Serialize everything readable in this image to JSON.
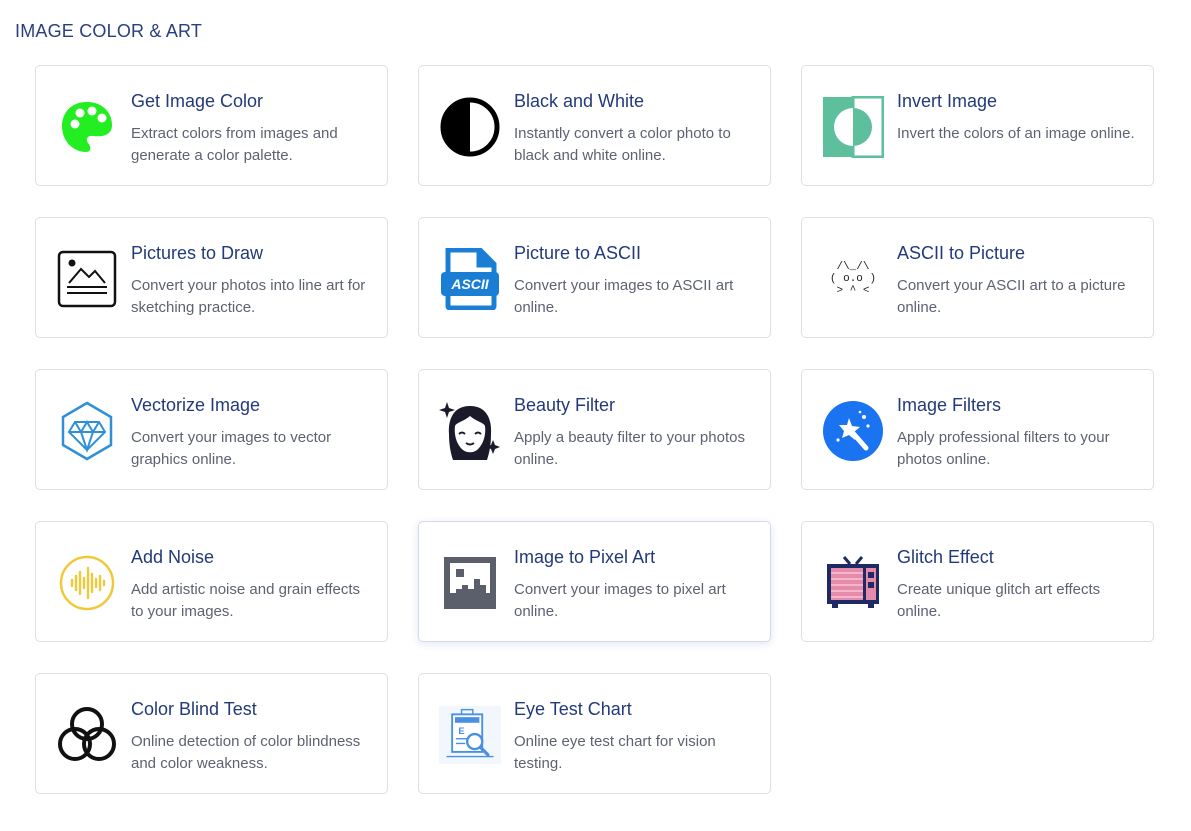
{
  "section": {
    "title": "IMAGE COLOR & ART"
  },
  "tools": [
    {
      "title": "Get Image Color",
      "desc": "Extract colors from images and generate a color palette.",
      "icon": "palette-icon"
    },
    {
      "title": "Black and White",
      "desc": "Instantly convert a color photo to black and white online.",
      "icon": "contrast-icon"
    },
    {
      "title": "Invert Image",
      "desc": "Invert the colors of an image online.",
      "icon": "invert-icon"
    },
    {
      "title": "Pictures to Draw",
      "desc": "Convert your photos into line art for sketching practice.",
      "icon": "sketch-picture-icon"
    },
    {
      "title": "Picture to ASCII",
      "desc": "Convert your images to ASCII art online.",
      "icon": "ascii-file-icon",
      "icon_text": "ASCII"
    },
    {
      "title": "ASCII to Picture",
      "desc": "Convert your ASCII art to a picture online.",
      "icon": "ascii-face-icon",
      "icon_lines": [
        "/\\_/\\",
        "( o.o )",
        "> ^ <"
      ]
    },
    {
      "title": "Vectorize Image",
      "desc": "Convert your images to vector graphics online.",
      "icon": "vector-gem-icon"
    },
    {
      "title": "Beauty Filter",
      "desc": "Apply a beauty filter to your photos online.",
      "icon": "beauty-face-icon"
    },
    {
      "title": "Image Filters",
      "desc": "Apply professional filters to your photos online.",
      "icon": "magic-wand-icon"
    },
    {
      "title": "Add Noise",
      "desc": "Add artistic noise and grain effects to your images.",
      "icon": "sound-wave-icon"
    },
    {
      "title": "Image to Pixel Art",
      "desc": "Convert your images to pixel art online.",
      "icon": "pixel-image-icon"
    },
    {
      "title": "Glitch Effect",
      "desc": "Create unique glitch art effects online.",
      "icon": "glitch-tv-icon"
    },
    {
      "title": "Color Blind Test",
      "desc": "Online detection of color blindness and color weakness.",
      "icon": "color-circles-icon"
    },
    {
      "title": "Eye Test Chart",
      "desc": "Online eye test chart for vision testing.",
      "icon": "eye-chart-icon",
      "icon_text": "E"
    }
  ],
  "colors": {
    "title": "#233a7a",
    "text": "#5c6270",
    "border": "#dcdfe6",
    "palette_green": "#22ee22",
    "invert_green": "#5dbf9c",
    "ascii_blue": "#1a7fd4",
    "vector_blue": "#2f8fd8",
    "filter_blue": "#1a73f0",
    "noise_yellow": "#f0c93a",
    "glitch_pink": "#e58aa8",
    "glitch_navy": "#1e2a66"
  }
}
